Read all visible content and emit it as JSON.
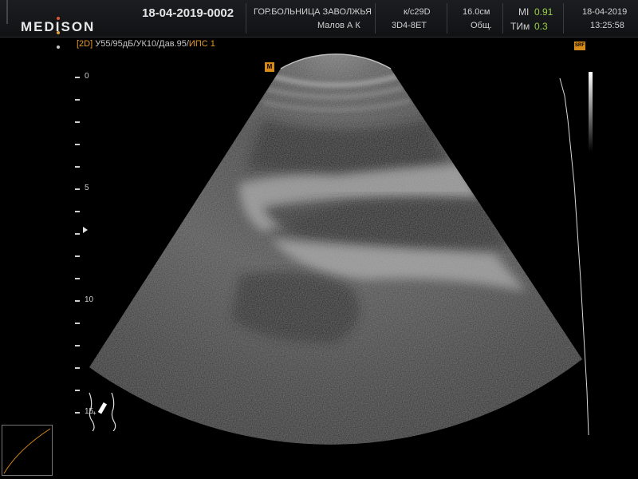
{
  "header": {
    "logo": "MEDISON",
    "logo_dot_colors": [
      "#e4572e",
      "#e8a13a",
      "#c9c9c9"
    ],
    "patient_id": "18-04-2019-0002",
    "hospital": "ГОР.БОЛЬНИЦА ЗАВОЛЖЬЯ",
    "doctor": "Малов А К",
    "preset": "к/с29D",
    "probe": "3D4-8ET",
    "depth": "16.0см",
    "application": "Общ.",
    "mi_label": "MI",
    "mi_value": "0.91",
    "tim_label": "ТИм",
    "tim_value": "0.3",
    "date": "18-04-2019",
    "time": "13:25:58"
  },
  "imaging": {
    "mode": "[2D]",
    "params": "У55/95дБ/УК10/Дав.95/",
    "ips": "ИПС 1",
    "srf_badge": "SRF",
    "depth_labels": [
      "0",
      "5",
      "10",
      "15"
    ],
    "accent_color": "#d68a1a",
    "mi_color": "#9ad04a"
  }
}
